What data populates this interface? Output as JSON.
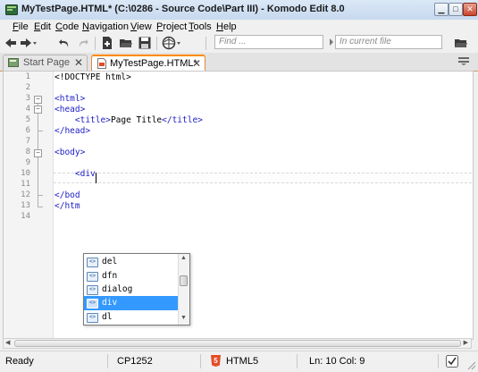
{
  "window": {
    "title": "MyTestPage.HTML* (C:\\0286 - Source Code\\Part III) - Komodo Edit 8.0",
    "minimize_glyph": "▁",
    "maximize_glyph": "□",
    "close_glyph": "✕"
  },
  "menubar": [
    {
      "label": "File",
      "u": "F",
      "rest": "ile"
    },
    {
      "label": "Edit",
      "u": "E",
      "rest": "dit"
    },
    {
      "label": "Code",
      "u": "C",
      "rest": "ode"
    },
    {
      "label": "Navigation",
      "u": "N",
      "rest": "avigation"
    },
    {
      "label": "View",
      "u": "V",
      "rest": "iew"
    },
    {
      "label": "Project",
      "u": "P",
      "rest": "roject"
    },
    {
      "label": "Tools",
      "u": "T",
      "rest": "ools"
    },
    {
      "label": "Help",
      "u": "H",
      "rest": "elp"
    }
  ],
  "toolbar": {
    "find_placeholder": "Find ...",
    "scope_placeholder": "In current file",
    "icons": [
      "back-arrow-icon",
      "forward-arrow-icon",
      "undo-icon",
      "redo-icon",
      "new-file-icon",
      "open-folder-icon",
      "save-icon",
      "browser-preview-icon",
      "find-folder-icon"
    ]
  },
  "tabs": [
    {
      "label": "Start Page",
      "close": "✕",
      "active": false
    },
    {
      "label": "MyTestPage.HTML*",
      "close": "✕",
      "active": true
    }
  ],
  "editor": {
    "line_numbers": [
      "1",
      "2",
      "3",
      "4",
      "5",
      "6",
      "7",
      "8",
      "9",
      "10",
      "11",
      "12",
      "13",
      "14"
    ],
    "lines": [
      [
        {
          "t": "<!DOCTYPE html>",
          "c": "plain"
        }
      ],
      [],
      [
        {
          "t": "<html>",
          "c": "tag"
        }
      ],
      [
        {
          "t": "<head>",
          "c": "tag"
        }
      ],
      [
        {
          "t": "    ",
          "c": "plain"
        },
        {
          "t": "<title>",
          "c": "tag"
        },
        {
          "t": "Page Title",
          "c": "plain"
        },
        {
          "t": "</title>",
          "c": "tag"
        }
      ],
      [
        {
          "t": "</head>",
          "c": "tag"
        }
      ],
      [],
      [
        {
          "t": "<body>",
          "c": "tag"
        }
      ],
      [],
      [
        {
          "t": "    ",
          "c": "plain"
        },
        {
          "t": "<div",
          "c": "tag"
        }
      ],
      [],
      [
        {
          "t": "</bod",
          "c": "tag"
        }
      ],
      [
        {
          "t": "</htm",
          "c": "tag"
        }
      ],
      []
    ]
  },
  "autocomplete": {
    "items": [
      "del",
      "dfn",
      "dialog",
      "div",
      "dl"
    ],
    "selected": "div",
    "item_icon": "<>",
    "scroll_up": "▲",
    "scroll_down": "▼"
  },
  "statusbar": {
    "ready": "Ready",
    "encoding": "CP1252",
    "language": "HTML5",
    "html5_badge": "5",
    "position": "Ln: 10 Col: 9"
  },
  "colors": {
    "tag_blue": "#2020c8",
    "selection": "#3399ff",
    "active_tab_accent": "#ff8a00"
  }
}
